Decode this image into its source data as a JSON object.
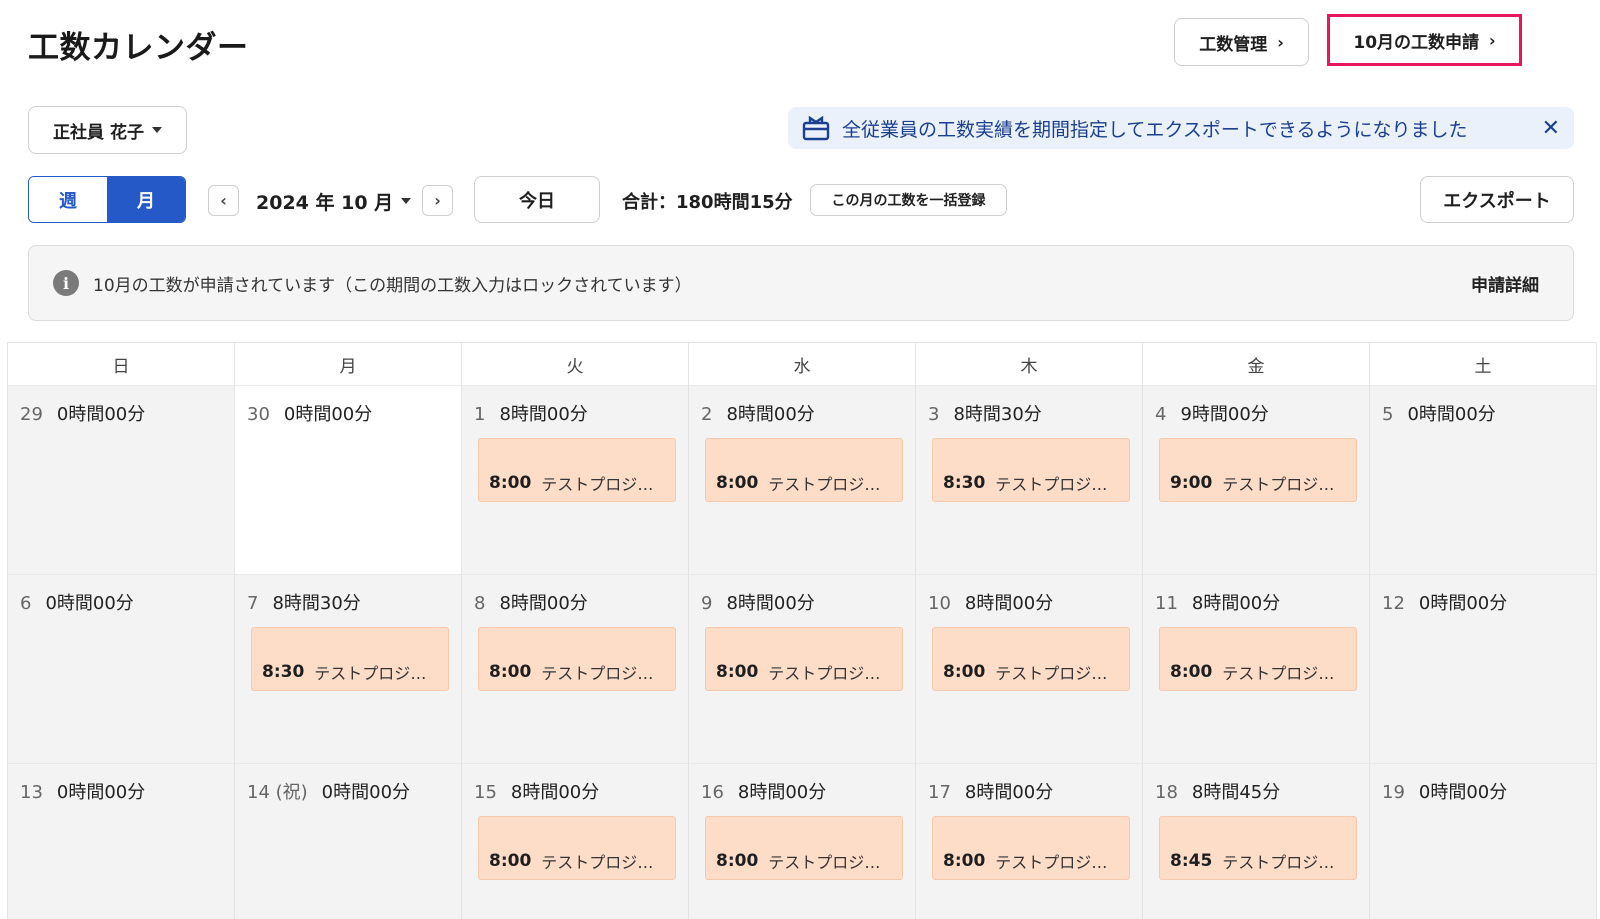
{
  "header": {
    "title": "工数カレンダー",
    "manage_label": "工数管理",
    "apply_label": "10月の工数申請"
  },
  "user_select": {
    "value": "正社員 花子"
  },
  "notice": {
    "text": "全従業員の工数実績を期間指定してエクスポートできるようになりました",
    "close": "✕"
  },
  "toolbar": {
    "view_week": "週",
    "view_month": "月",
    "prev": "‹",
    "next": "›",
    "period": "2024 年 10 月",
    "today": "今日",
    "total": "合計：180時間15分",
    "bulk": "この月の工数を一括登録",
    "export": "エクスポート"
  },
  "lock": {
    "icon": "i",
    "message": "10月の工数が申請されています（この期間の工数入力はロックされています）",
    "detail": "申請詳細"
  },
  "calendar": {
    "weekdays": [
      "日",
      "月",
      "火",
      "水",
      "木",
      "金",
      "土"
    ],
    "days": [
      {
        "num": "29",
        "hours": "0時間00分",
        "white": false
      },
      {
        "num": "30",
        "hours": "0時間00分",
        "white": true
      },
      {
        "num": "1",
        "hours": "8時間00分",
        "entry": {
          "time": "8:00",
          "project": "テストプロジェ..."
        }
      },
      {
        "num": "2",
        "hours": "8時間00分",
        "entry": {
          "time": "8:00",
          "project": "テストプロジェ..."
        }
      },
      {
        "num": "3",
        "hours": "8時間30分",
        "entry": {
          "time": "8:30",
          "project": "テストプロジェ..."
        }
      },
      {
        "num": "4",
        "hours": "9時間00分",
        "entry": {
          "time": "9:00",
          "project": "テストプロジェ..."
        }
      },
      {
        "num": "5",
        "hours": "0時間00分"
      },
      {
        "num": "6",
        "hours": "0時間00分"
      },
      {
        "num": "7",
        "hours": "8時間30分",
        "entry": {
          "time": "8:30",
          "project": "テストプロジェ..."
        }
      },
      {
        "num": "8",
        "hours": "8時間00分",
        "entry": {
          "time": "8:00",
          "project": "テストプロジェ..."
        }
      },
      {
        "num": "9",
        "hours": "8時間00分",
        "entry": {
          "time": "8:00",
          "project": "テストプロジェ..."
        }
      },
      {
        "num": "10",
        "hours": "8時間00分",
        "entry": {
          "time": "8:00",
          "project": "テストプロジェ..."
        }
      },
      {
        "num": "11",
        "hours": "8時間00分",
        "entry": {
          "time": "8:00",
          "project": "テストプロジェ..."
        }
      },
      {
        "num": "12",
        "hours": "0時間00分"
      },
      {
        "num": "13",
        "hours": "0時間00分"
      },
      {
        "num": "14 (祝)",
        "hours": "0時間00分"
      },
      {
        "num": "15",
        "hours": "8時間00分",
        "entry": {
          "time": "8:00",
          "project": "テストプロジェ..."
        }
      },
      {
        "num": "16",
        "hours": "8時間00分",
        "entry": {
          "time": "8:00",
          "project": "テストプロジェ..."
        }
      },
      {
        "num": "17",
        "hours": "8時間00分",
        "entry": {
          "time": "8:00",
          "project": "テストプロジェ..."
        }
      },
      {
        "num": "18",
        "hours": "8時間45分",
        "entry": {
          "time": "8:45",
          "project": "テストプロジェ..."
        }
      },
      {
        "num": "19",
        "hours": "0時間00分"
      }
    ]
  },
  "colors": {
    "accent": "#2459c7",
    "highlight": "#e8175d",
    "entry_bg": "#fddcc8",
    "notice_bg": "#eaf1fb"
  }
}
